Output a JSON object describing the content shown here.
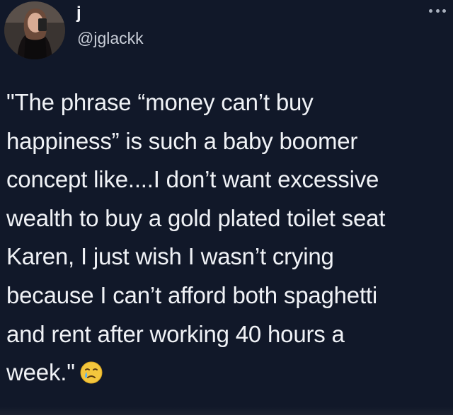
{
  "author": {
    "display_name": "j",
    "handle": "@jglackk"
  },
  "menu": {
    "icon": "more-horizontal-icon"
  },
  "tweet": {
    "lines": [
      "\"The phrase “money can’t buy",
      "happiness” is such a baby boomer",
      "concept like....I don’t want excessive",
      "wealth to buy a gold plated toilet seat",
      "Karen, I just wish I wasn’t crying",
      "because I can’t afford both spaghetti",
      "and rent after working 40 hours a",
      "week.\""
    ],
    "emoji": "crying-face-emoji"
  },
  "colors": {
    "background": "#111829",
    "text": "#f0f2f6",
    "handle": "#c9ced8"
  }
}
